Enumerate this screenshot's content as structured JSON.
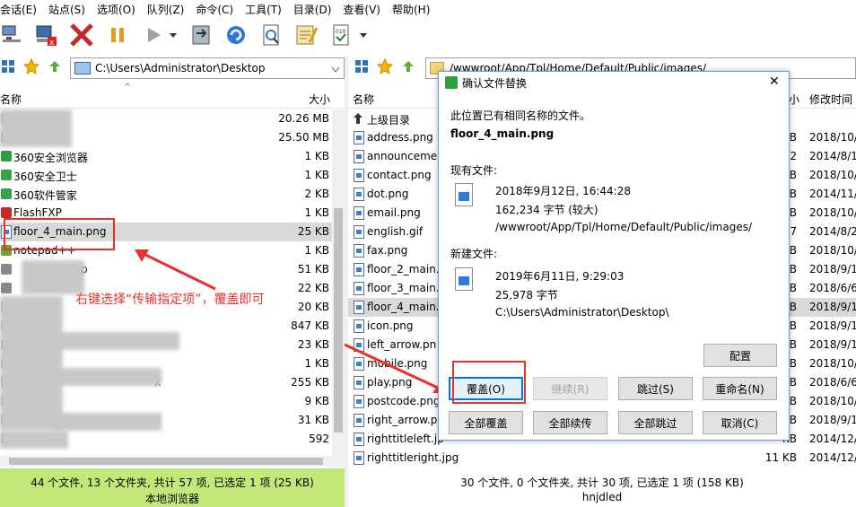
{
  "menu": [
    "会话(E)",
    "站点(S)",
    "选项(O)",
    "队列(Z)",
    "命令(C)",
    "工具(T)",
    "目录(D)",
    "查看(V)",
    "帮助(H)"
  ],
  "colors": {
    "accent": "#3b7fd0",
    "statusLeft": "#c3e879",
    "highlight": "#cce4f7",
    "red": "#e8312c",
    "annotation": "#e8312c"
  },
  "left": {
    "path": "C:\\Users\\Administrator\\Desktop",
    "col_name": "名称",
    "col_size": "大小",
    "rows": [
      {
        "name": "",
        "size": "20.26 MB"
      },
      {
        "name": "",
        "size": "25.50 MB"
      },
      {
        "name": "360安全浏览器",
        "size": "1 KB"
      },
      {
        "name": "360安全卫士",
        "size": "1 KB"
      },
      {
        "name": "360软件管家",
        "size": "2 KB"
      },
      {
        "name": "FlashFXP",
        "size": "1 KB"
      },
      {
        "name": "floor_4_main.png",
        "size": "25 KB"
      },
      {
        "name": "notepad++",
        "size": "1 KB"
      },
      {
        "name": "p",
        "size": "51 KB"
      },
      {
        "name": "",
        "size": "22 KB"
      },
      {
        "name": "",
        "size": "20 KB"
      },
      {
        "name": "",
        "size": "847 KB"
      },
      {
        "name": "",
        "size": "23 KB"
      },
      {
        "name": "",
        "size": "1 KB"
      },
      {
        "name": "x",
        "size": "255 KB"
      },
      {
        "name": "",
        "size": "9 KB"
      },
      {
        "name": "x",
        "size": "31 KB"
      },
      {
        "name": "",
        "size": "592"
      }
    ],
    "status_line1": "44 个文件, 13 个文件夹, 共计 57 项, 已选定 1 项 (25 KB)",
    "status_line2": "本地浏览器"
  },
  "right": {
    "path": "/wwwroot/App/Tpl/Home/Default/Public/images/",
    "col_name": "名称",
    "col_size": "小",
    "col_date": "修改时间",
    "rows": [
      {
        "name": "上级目录",
        "size": "",
        "date": ""
      },
      {
        "name": "address.png",
        "size": "KB",
        "date": "2018/10/"
      },
      {
        "name": "announcemen",
        "size": "2",
        "date": "2014/8/1"
      },
      {
        "name": "contact.png",
        "size": "KB",
        "date": "2018/10/"
      },
      {
        "name": "dot.png",
        "size": "KB",
        "date": "2014/11/"
      },
      {
        "name": "email.png",
        "size": "KB",
        "date": "2018/10/"
      },
      {
        "name": "english.gif",
        "size": "57",
        "date": "2014/8/2"
      },
      {
        "name": "fax.png",
        "size": "KB",
        "date": "2018/10/"
      },
      {
        "name": "floor_2_main.j",
        "size": "KB",
        "date": "2018/9/1"
      },
      {
        "name": "floor_3_main.j",
        "size": "KB",
        "date": "2018/6/6"
      },
      {
        "name": "floor_4_main.p",
        "size": "KB",
        "date": "2018/9/1"
      },
      {
        "name": "icon.png",
        "size": "KB",
        "date": "2018/9/1"
      },
      {
        "name": "left_arrow.pn",
        "size": "KB",
        "date": "2018/9/1"
      },
      {
        "name": "mobile.png",
        "size": "KB",
        "date": "2018/10/"
      },
      {
        "name": "play.png",
        "size": "KB",
        "date": "2018/6/6"
      },
      {
        "name": "postcode.png",
        "size": "KB",
        "date": "2018/10/"
      },
      {
        "name": "right_arrow.p",
        "size": "KB",
        "date": "2018/9/1"
      },
      {
        "name": "righttitleleft.jp",
        "size": "KB",
        "date": "2014/12/"
      },
      {
        "name": "righttitleright.jpg",
        "size": "11 KB",
        "date": "2014/12/"
      }
    ],
    "status_line1": "30 个文件, 0 个文件夹, 共计 30 项, 已选定 1 项 (158 KB)",
    "status_line2": "hnjdled"
  },
  "dialog": {
    "title": "确认文件替换",
    "message": "此位置已有相同名称的文件。",
    "filename": "floor_4_main.png",
    "existing_label": "现有文件:",
    "existing_date": "2018年9月12日, 16:44:28",
    "existing_size": "162,234 字节 (较大)",
    "existing_path": "/wwwroot/App/Tpl/Home/Default/Public/images/",
    "new_label": "新建文件:",
    "new_date": "2019年6月11日, 9:29:03",
    "new_size": "25,978 字节",
    "new_path": "C:\\Users\\Administrator\\Desktop\\",
    "btn_config": "配置",
    "btn_overwrite": "覆盖(O)",
    "btn_resume": "继续(R)",
    "btn_skip": "跳过(S)",
    "btn_rename": "重命名(N)",
    "btn_overwrite_all": "全部覆盖",
    "btn_resume_all": "全部续传",
    "btn_skip_all": "全部跳过",
    "btn_cancel": "取消(C)",
    "close": "✕"
  },
  "annotation": "右键选择“传输指定项”，覆盖即可"
}
